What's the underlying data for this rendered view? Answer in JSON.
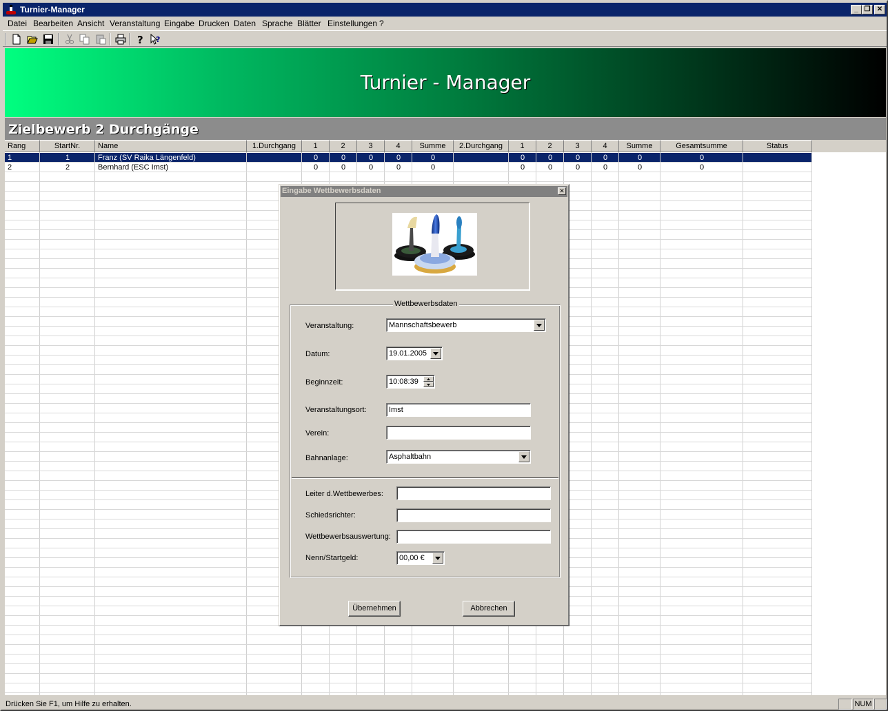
{
  "window": {
    "title": "Turnier-Manager",
    "buttons": [
      "_",
      "❐",
      "✕"
    ]
  },
  "menu": [
    "Datei",
    "Bearbeiten",
    "Ansicht",
    "Veranstaltung",
    "Eingabe",
    "Drucken",
    "Daten",
    "Sprache",
    "Blätter",
    "Einstellungen",
    "?"
  ],
  "toolbar": {
    "icons": [
      "new-file-icon",
      "open-folder-icon",
      "save-icon",
      "cut-icon",
      "copy-icon",
      "paste-icon",
      "print-icon",
      "help-icon",
      "context-help-icon"
    ]
  },
  "banner": {
    "title": "Turnier - Manager"
  },
  "section": {
    "title": "Zielbewerb 2 Durchgänge"
  },
  "grid": {
    "columns": [
      "Rang",
      "StartNr.",
      "Name",
      "1.Durchgang",
      "1",
      "2",
      "3",
      "4",
      "Summe",
      "2.Durchgang",
      "1",
      "2",
      "3",
      "4",
      "Summe",
      "Gesamtsumme",
      "Status"
    ],
    "rows": [
      [
        "1",
        "1",
        "Franz (SV Raika Längenfeld)",
        "",
        "0",
        "0",
        "0",
        "0",
        "0",
        "",
        "0",
        "0",
        "0",
        "0",
        "0",
        "0",
        ""
      ],
      [
        "2",
        "2",
        "Bernhard (ESC Imst)",
        "",
        "0",
        "0",
        "0",
        "0",
        "0",
        "",
        "0",
        "0",
        "0",
        "0",
        "0",
        "0",
        ""
      ]
    ],
    "selected_row": 0
  },
  "status": {
    "text": "Drücken Sie F1, um Hilfe zu erhalten.",
    "num": "NUM"
  },
  "dialog": {
    "title": "Eingabe Wettbewerbsdaten",
    "close": "✕",
    "group_caption": "Wettbewerbsdaten",
    "veranstaltung_label": "Veranstaltung:",
    "veranstaltung_value": "Mannschaftsbewerb",
    "datum_label": "Datum:",
    "datum_value": "19.01.2005",
    "beginnzeit_label": "Beginnzeit:",
    "beginnzeit_value": "10:08:39",
    "ort_label": "Veranstaltungsort:",
    "ort_value": "Imst",
    "verein_label": "Verein:",
    "verein_value": "",
    "bahn_label": "Bahnanlage:",
    "bahn_value": "Asphaltbahn",
    "leiter_label": "Leiter d.Wettbewerbes:",
    "leiter_value": "",
    "schiedsrichter_label": "Schiedsrichter:",
    "schiedsrichter_value": "",
    "auswertung_label": "Wettbewerbsauswertung:",
    "auswertung_value": "",
    "startgeld_label": "Nenn/Startgeld:",
    "startgeld_value": "00,00  €",
    "ok_label": "Übernehmen",
    "cancel_label": "Abbrechen"
  }
}
